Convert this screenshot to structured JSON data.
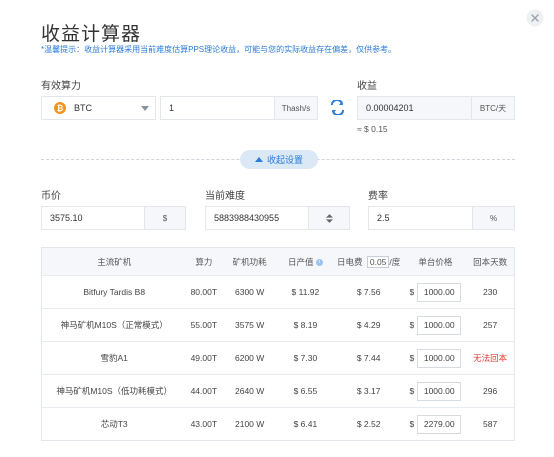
{
  "title": "收益计算器",
  "tip": "*温馨提示：收益计算器采用当前难度估算PPS理论收益，可能与您的实际收益存在偏差，仅供参考。",
  "hashrate": {
    "label": "有效算力",
    "coin": "BTC",
    "value": "1",
    "unit": "Thash/s"
  },
  "income": {
    "label": "收益",
    "value": "0.00004201",
    "unit": "BTC/天",
    "usd": "≈ $ 0.15"
  },
  "collapse_label": "收起设置",
  "coin_price": {
    "label": "币价",
    "value": "3575.10",
    "unit": "$"
  },
  "difficulty": {
    "label": "当前难度",
    "value": "5883988430955"
  },
  "fee": {
    "label": "费率",
    "value": "2.5",
    "unit": "%"
  },
  "table": {
    "headers": {
      "model": "主流矿机",
      "hashrate": "算力",
      "power": "矿机功耗",
      "daily_output": "日产值",
      "electricity_prefix": "日电费",
      "electricity_value": "0.05",
      "electricity_suffix": "/度",
      "unit_price": "单台价格",
      "payback": "回本天数"
    },
    "rows": [
      {
        "model": "Bitfury Tardis B8",
        "hashrate": "80.00T",
        "power": "6300 W",
        "output": "$ 11.92",
        "electricity": "$ 7.56",
        "currency": "$",
        "price": "1000.00",
        "payback": "230"
      },
      {
        "model": "神马矿机M10S（正常模式）",
        "hashrate": "55.00T",
        "power": "3575 W",
        "output": "$ 8.19",
        "electricity": "$ 4.29",
        "currency": "$",
        "price": "1000.00",
        "payback": "257"
      },
      {
        "model": "雪豹A1",
        "hashrate": "49.00T",
        "power": "6200 W",
        "output": "$ 7.30",
        "electricity": "$ 7.44",
        "currency": "$",
        "price": "1000.00",
        "payback": "无法回本"
      },
      {
        "model": "神马矿机M10S（低功耗模式）",
        "hashrate": "44.00T",
        "power": "2640 W",
        "output": "$ 6.55",
        "electricity": "$ 3.17",
        "currency": "$",
        "price": "1000.00",
        "payback": "296"
      },
      {
        "model": "芯动T3",
        "hashrate": "43.00T",
        "power": "2100 W",
        "output": "$ 6.41",
        "electricity": "$ 2.52",
        "currency": "$",
        "price": "2279.00",
        "payback": "587"
      }
    ]
  },
  "colors": {
    "accent": "#2b7bd8",
    "bitcoin": "#f7931a",
    "danger": "#e53935"
  }
}
